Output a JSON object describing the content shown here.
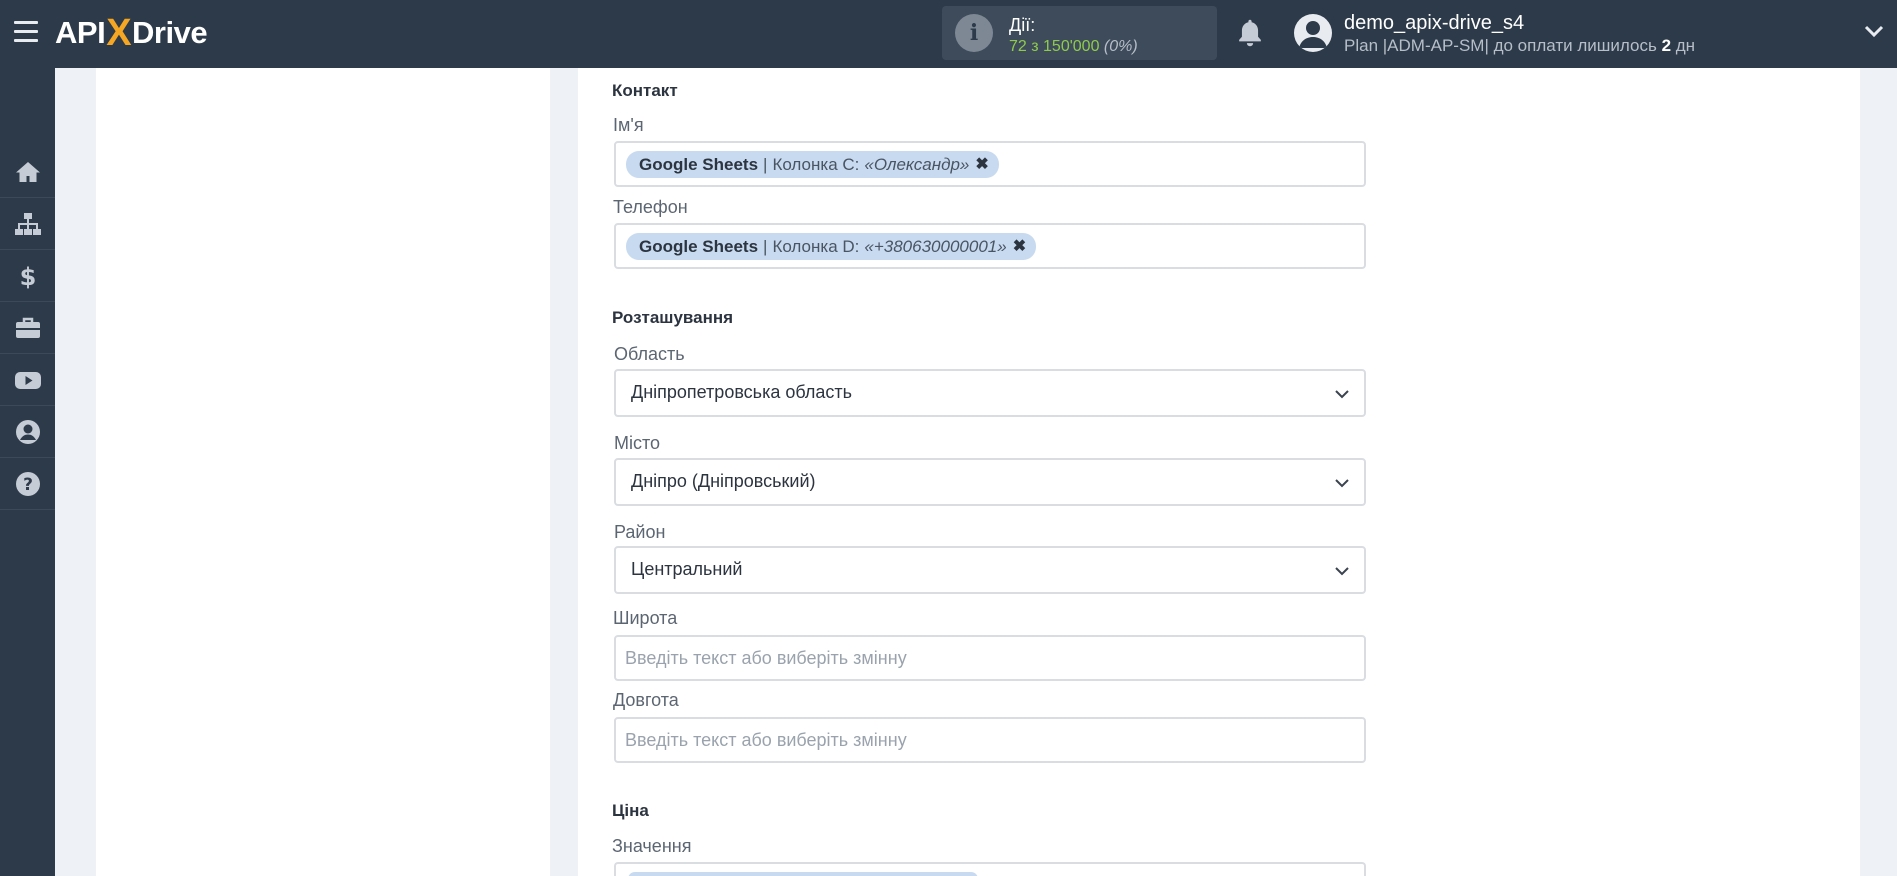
{
  "header": {
    "logo_api": "API",
    "logo_x": "X",
    "logo_drive": "Drive",
    "actions_label": "Дії:",
    "actions_used": "72 з 150'000",
    "actions_percent": "(0%)",
    "user_name": "demo_apix-drive_s4",
    "plan_prefix": "Plan |ADM-AP-SM| до оплати лишилось",
    "plan_days": "2",
    "plan_suffix": "дн"
  },
  "sidebar": {
    "items": [
      {
        "icon": "home-icon"
      },
      {
        "icon": "sitemap-icon"
      },
      {
        "icon": "dollar-icon"
      },
      {
        "icon": "briefcase-icon"
      },
      {
        "icon": "youtube-icon"
      },
      {
        "icon": "user-circle-icon"
      },
      {
        "icon": "question-icon"
      }
    ]
  },
  "form": {
    "contact": {
      "title": "Контакт",
      "name_label": "Ім'я",
      "name_tag": {
        "source": "Google Sheets",
        "sep": "|",
        "column": "Колонка C:",
        "value": "«Олександр»",
        "remove": "✖"
      },
      "phone_label": "Телефон",
      "phone_tag": {
        "source": "Google Sheets",
        "sep": "|",
        "column": "Колонка D:",
        "value": "«+380630000001»",
        "remove": "✖"
      }
    },
    "location": {
      "title": "Розташування",
      "region_label": "Область",
      "region_value": "Дніпропетровська область",
      "city_label": "Місто",
      "city_value": "Дніпро (Дніпровський)",
      "district_label": "Район",
      "district_value": "Центральний",
      "lat_label": "Широта",
      "lat_placeholder": "Введіть текст або виберіть змінну",
      "lng_label": "Довгота",
      "lng_placeholder": "Введіть текст або виберіть змінну"
    },
    "price": {
      "title": "Ціна",
      "value_label": "Значення"
    }
  },
  "colors": {
    "topbar": "#2d3a4a",
    "accent_green": "#8ecb4c",
    "logo_x": "#f5a623",
    "tag_bg": "#c8daf0"
  }
}
